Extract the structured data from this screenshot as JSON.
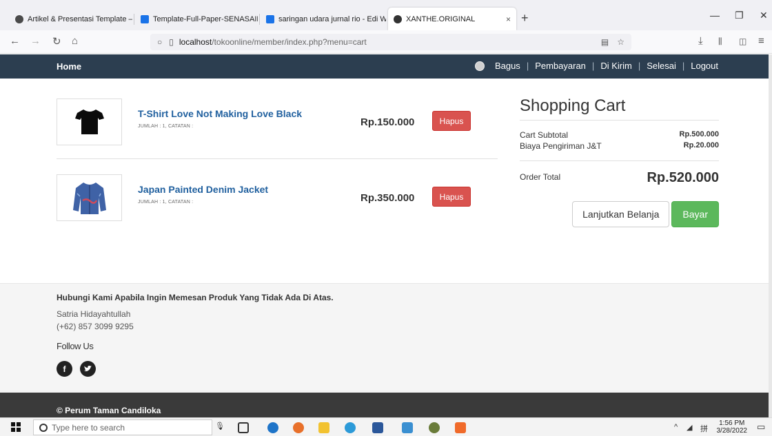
{
  "browser": {
    "tabs": [
      {
        "title": "Artikel & Presentasi Template –",
        "icon": "globe-icon",
        "color": "#4a4a4a"
      },
      {
        "title": "Template-Full-Paper-SENASAIN",
        "icon": "drive-icon",
        "color": "#1a73e8"
      },
      {
        "title": "saringan udara jurnal rio - Edi W",
        "icon": "drive-icon",
        "color": "#1a73e8"
      },
      {
        "title": "XANTHE.ORIGINAL",
        "icon": "site-icon",
        "color": "#333333"
      }
    ],
    "new_tab": "+",
    "url_host": "localhost",
    "url_path": "/tokoonline/member/index.php?menu=cart"
  },
  "nav": {
    "brand": "Home",
    "user": "Bagus",
    "links": [
      "Pembayaran",
      "Di Kirim",
      "Selesai",
      "Logout"
    ],
    "separator": "|"
  },
  "cart": {
    "items": [
      {
        "name": "T-Shirt Love Not Making Love Black",
        "meta": "JUMLAH : 1, CATATAN :",
        "price": "Rp.150.000",
        "remove_label": "Hapus",
        "image": "tshirt-image"
      },
      {
        "name": "Japan Painted Denim Jacket",
        "meta": "JUMLAH : 1, CATATAN :",
        "price": "Rp.350.000",
        "remove_label": "Hapus",
        "image": "jacket-image"
      }
    ]
  },
  "summary": {
    "title": "Shopping Cart",
    "subtotal_label": "Cart Subtotal",
    "subtotal_value": "Rp.500.000",
    "shipping_label": "Biaya Pengiriman J&T",
    "shipping_value": "Rp.20.000",
    "total_label": "Order Total",
    "total_value": "Rp.520.000",
    "continue_label": "Lanjutkan Belanja",
    "pay_label": "Bayar"
  },
  "footer": {
    "heading": "Hubungi Kami Apabila Ingin Memesan Produk Yang Tidak Ada Di Atas.",
    "contact_name": "Satria Hidayahtullah",
    "contact_phone": "(+62) 857 3099 9295",
    "follow_label": "Follow Us",
    "social": [
      "facebook-icon",
      "twitter-icon"
    ],
    "copyright": "© Perum Taman Candiloka"
  },
  "taskbar": {
    "search_placeholder": "Type here to search",
    "time": "1:56 PM",
    "date": "3/28/2022"
  },
  "colors": {
    "nav_bg": "#2c3e50",
    "remove_btn": "#d9534f",
    "pay_btn": "#5cb85c",
    "product_link": "#1f5f9e",
    "footer_bg": "#f5f5f5",
    "copyright_bar": "#3a3a3a"
  }
}
